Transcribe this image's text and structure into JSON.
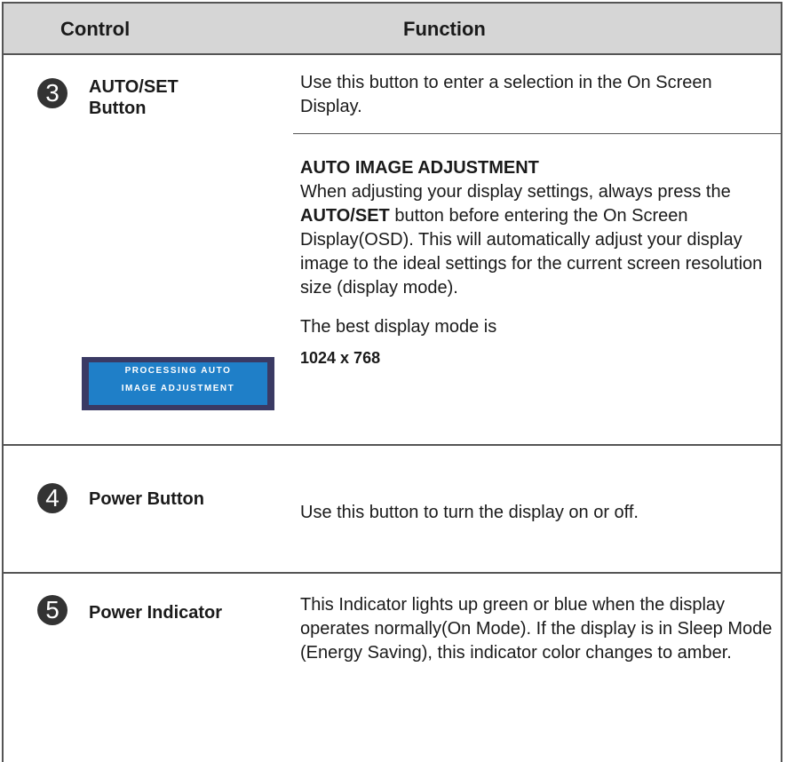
{
  "header": {
    "control": "Control",
    "function": "Function"
  },
  "rows": [
    {
      "number": "3",
      "control": "AUTO/SET Button",
      "fn1": "Use this button to enter a selection in the On Screen Display.",
      "fn_heading": "AUTO IMAGE ADJUSTMENT",
      "fn2_pre": "When adjusting your display settings, always press the ",
      "fn2_bold": "AUTO/SET",
      "fn2_post": " button before entering the On Screen Display(OSD). This will automatically adjust your display image to the ideal settings for the current screen resolution size (display mode).",
      "best_mode_label": "The best display mode is",
      "best_mode_value": "1024 x 768",
      "osd_line1": "PROCESSING AUTO",
      "osd_line2": "IMAGE ADJUSTMENT"
    },
    {
      "number": "4",
      "control": "Power Button",
      "fn1": "Use this button to turn the display on or off."
    },
    {
      "number": "5",
      "control": "Power Indicator",
      "fn1": "This Indicator lights up green or blue when the display operates normally(On Mode). If the display is in Sleep Mode (Energy Saving), this indicator color changes to amber."
    }
  ]
}
